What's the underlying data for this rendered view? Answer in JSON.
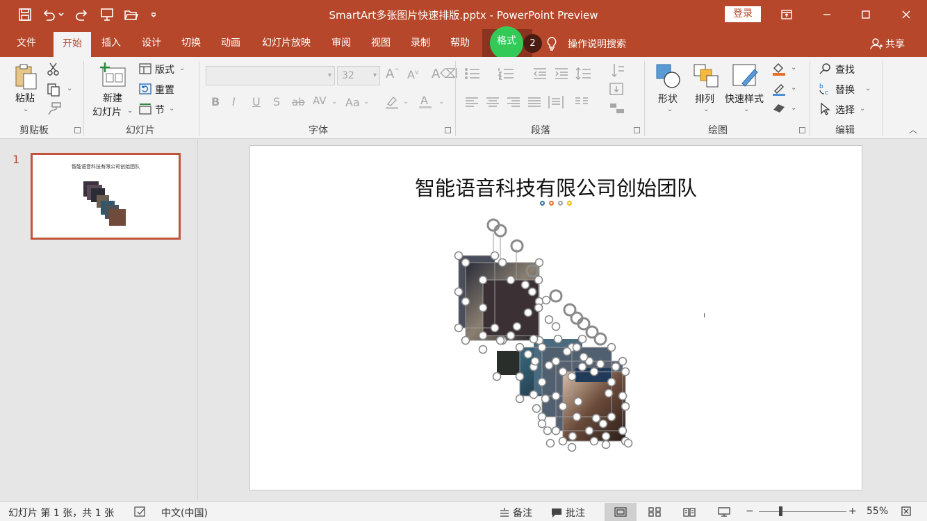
{
  "window": {
    "title": "SmartArt多张图片快速排版.pptx  -  PowerPoint Preview",
    "login_label": "登录"
  },
  "tabs": [
    {
      "label": "文件"
    },
    {
      "label": "开始"
    },
    {
      "label": "插入"
    },
    {
      "label": "设计"
    },
    {
      "label": "切换"
    },
    {
      "label": "动画"
    },
    {
      "label": "幻灯片放映"
    },
    {
      "label": "审阅"
    },
    {
      "label": "视图"
    },
    {
      "label": "录制"
    },
    {
      "label": "帮助"
    },
    {
      "label": "格式"
    }
  ],
  "tell_me": "操作说明搜索",
  "share_label": "共享",
  "tutorial_badge": "2",
  "ribbon": {
    "clipboard": {
      "paste": "粘贴",
      "group": "剪贴板"
    },
    "slides": {
      "new_line1": "新建",
      "new_line2": "幻灯片",
      "layout": "版式",
      "reset": "重置",
      "section": "节",
      "group": "幻灯片"
    },
    "font": {
      "font_size": "32",
      "group": "字体",
      "bold": "B",
      "italic": "I",
      "underline": "U",
      "shadow": "S",
      "strike": "ab",
      "spacing": "AV",
      "case": "Aa"
    },
    "paragraph": {
      "group": "段落"
    },
    "drawing": {
      "shape": "形状",
      "arrange": "排列",
      "quick_styles": "快速样式",
      "group": "绘图"
    },
    "editing": {
      "find": "查找",
      "replace": "替换",
      "select": "选择",
      "group": "编辑"
    }
  },
  "thumbnail": {
    "number": "1",
    "title": "智能语音科技有限公司创始团队"
  },
  "slide": {
    "title": "智能语音科技有限公司创始团队"
  },
  "status": {
    "slide_info": "幻灯片 第 1 张，共 1 张",
    "language": "中文(中国)",
    "notes": "备注",
    "comments": "批注",
    "zoom": "55%"
  },
  "colors": {
    "brand": "#b7472a",
    "highlight": "#2fd35b"
  }
}
